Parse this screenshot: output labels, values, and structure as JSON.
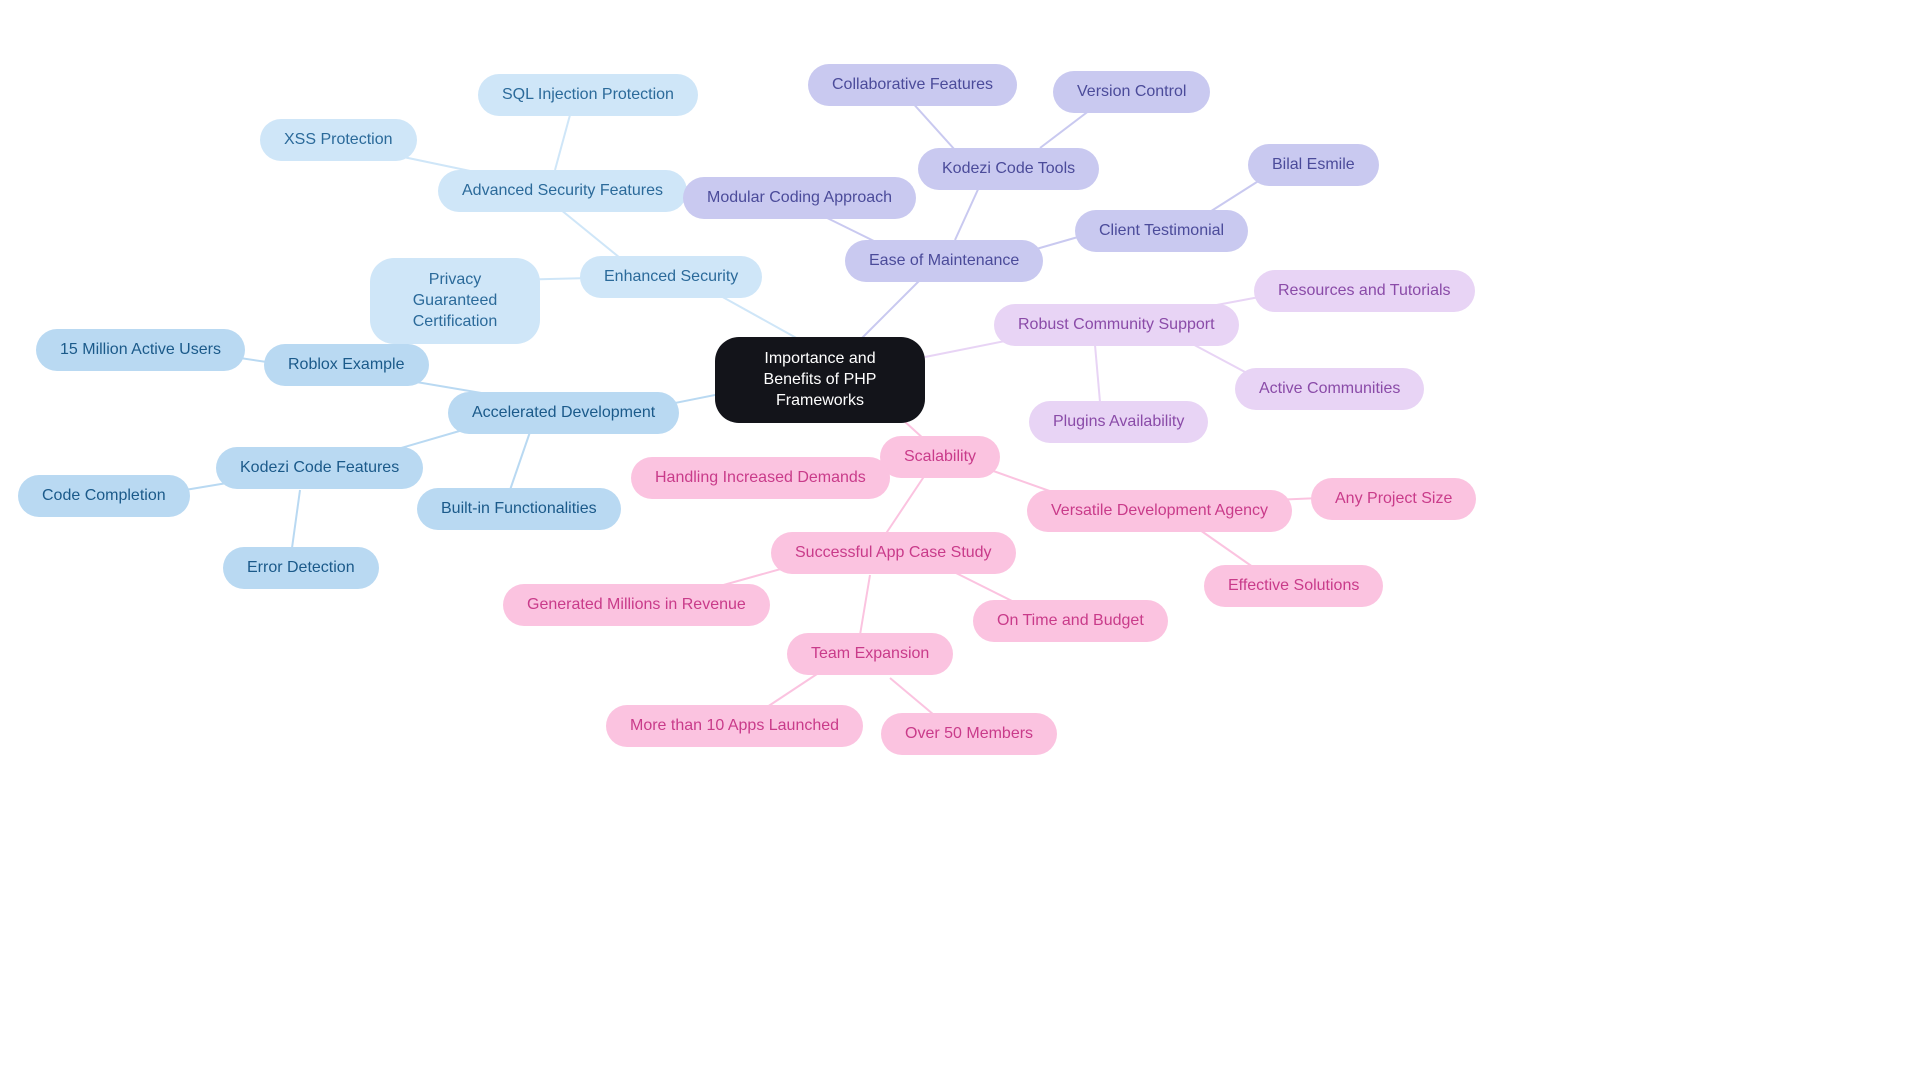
{
  "center": "Importance and Benefits of PHP Frameworks",
  "blue": {
    "enhanced_security": "Enhanced Security",
    "advanced_security": "Advanced Security Features",
    "sql_injection": "SQL Injection Protection",
    "xss_protection": "XSS Protection",
    "privacy_cert": "Privacy Guaranteed Certification",
    "accelerated_dev": "Accelerated Development",
    "roblox": "Roblox Example",
    "active_users": "15 Million Active Users",
    "kodezi_features": "Kodezi Code Features",
    "code_completion": "Code Completion",
    "error_detection": "Error Detection",
    "builtin": "Built-in Functionalities"
  },
  "purple": {
    "ease_maintenance": "Ease of Maintenance",
    "modular": "Modular Coding Approach",
    "kodezi_tools": "Kodezi Code Tools",
    "collab_features": "Collaborative Features",
    "version_control": "Version Control",
    "client_testimonial": "Client Testimonial",
    "bilal": "Bilal Esmile",
    "community_support": "Robust Community Support",
    "resources": "Resources and Tutorials",
    "active_comm": "Active Communities",
    "plugins": "Plugins Availability"
  },
  "pink": {
    "scalability": "Scalability",
    "handling_demands": "Handling Increased Demands",
    "versatile_agency": "Versatile Development Agency",
    "any_project": "Any Project Size",
    "effective": "Effective Solutions",
    "case_study": "Successful App Case Study",
    "revenue": "Generated Millions in Revenue",
    "on_time": "On Time and Budget",
    "team_expansion": "Team Expansion",
    "apps_launched": "More than 10 Apps Launched",
    "members": "Over 50 Members"
  }
}
